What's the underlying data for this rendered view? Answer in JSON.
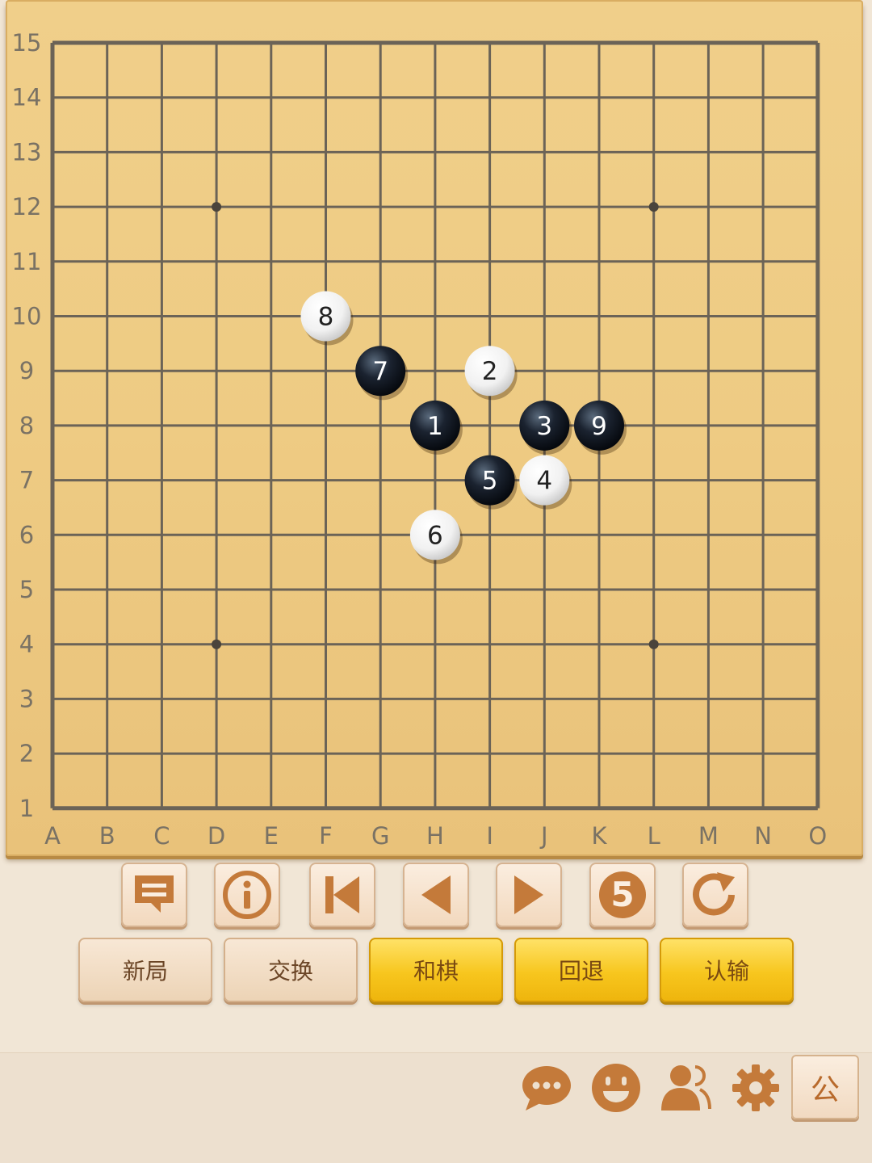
{
  "board": {
    "size": 15,
    "column_labels": [
      "A",
      "B",
      "C",
      "D",
      "E",
      "F",
      "G",
      "H",
      "I",
      "J",
      "K",
      "L",
      "M",
      "N",
      "O"
    ],
    "row_labels": [
      "1",
      "2",
      "3",
      "4",
      "5",
      "6",
      "7",
      "8",
      "9",
      "10",
      "11",
      "12",
      "13",
      "14",
      "15"
    ],
    "star_points": [
      "D12",
      "L12",
      "D4",
      "L4"
    ],
    "stones": [
      {
        "move": "1",
        "color": "black",
        "point": "H8"
      },
      {
        "move": "2",
        "color": "white",
        "point": "I9"
      },
      {
        "move": "3",
        "color": "black",
        "point": "J8"
      },
      {
        "move": "4",
        "color": "white",
        "point": "J7"
      },
      {
        "move": "5",
        "color": "black",
        "point": "I7"
      },
      {
        "move": "6",
        "color": "white",
        "point": "H6"
      },
      {
        "move": "7",
        "color": "black",
        "point": "G9"
      },
      {
        "move": "8",
        "color": "white",
        "point": "F10"
      },
      {
        "move": "9",
        "color": "black",
        "point": "K8"
      }
    ]
  },
  "controls": [
    {
      "name": "chat-log-button",
      "icon": "message-icon"
    },
    {
      "name": "info-button",
      "icon": "info-icon"
    },
    {
      "name": "first-move-button",
      "icon": "skip-to-start-icon"
    },
    {
      "name": "previous-move-button",
      "icon": "play-left-icon"
    },
    {
      "name": "next-move-button",
      "icon": "play-right-icon"
    },
    {
      "name": "five-button",
      "icon": "number-five-icon",
      "text": "5"
    },
    {
      "name": "refresh-button",
      "icon": "refresh-icon"
    }
  ],
  "actions": {
    "new_game": "新局",
    "swap": "交换",
    "draw": "和棋",
    "undo": "回退",
    "resign": "认输"
  },
  "bottom_bar": {
    "icons": [
      "chat-bubble-icon",
      "emoji-icon",
      "players-icon",
      "settings-icon"
    ],
    "public_label": "公"
  },
  "colors": {
    "accent_brown": "#c47a3a",
    "gold_button": "#f7c61e",
    "grid_line": "#6b6357"
  }
}
